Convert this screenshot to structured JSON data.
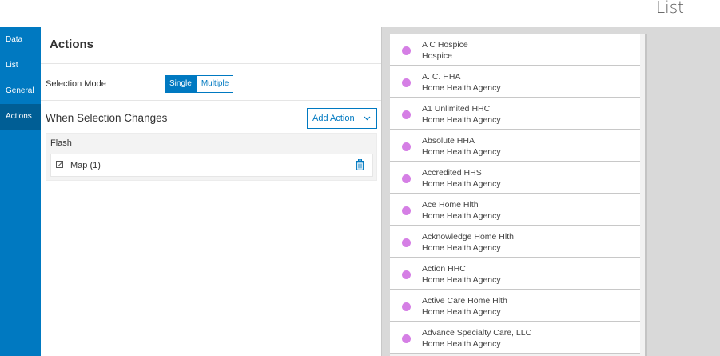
{
  "header": {
    "title": "List"
  },
  "tabs": [
    {
      "label": "Data",
      "active": false
    },
    {
      "label": "List",
      "active": false
    },
    {
      "label": "General",
      "active": false
    },
    {
      "label": "Actions",
      "active": true
    }
  ],
  "panel": {
    "title": "Actions",
    "selection_mode": {
      "label": "Selection Mode",
      "options": [
        "Single",
        "Multiple"
      ],
      "selected": "Single"
    },
    "when_selection_changes": "When Selection Changes",
    "add_action_label": "Add Action",
    "action": {
      "name": "Flash",
      "target": "Map (1)"
    }
  },
  "colors": {
    "accent": "#0079c1",
    "accent_dark": "#005e95",
    "dot": "#d57fe5"
  },
  "list": {
    "items": [
      {
        "name": "A C Hospice",
        "type": "Hospice"
      },
      {
        "name": "A. C. HHA",
        "type": "Home Health Agency"
      },
      {
        "name": "A1 Unlimited HHC",
        "type": "Home Health Agency"
      },
      {
        "name": "Absolute HHA",
        "type": "Home Health Agency"
      },
      {
        "name": "Accredited HHS",
        "type": "Home Health Agency"
      },
      {
        "name": "Ace Home Hlth",
        "type": "Home Health Agency"
      },
      {
        "name": "Acknowledge Home Hlth",
        "type": "Home Health Agency"
      },
      {
        "name": "Action HHC",
        "type": "Home Health Agency"
      },
      {
        "name": "Active Care Home Hlth",
        "type": "Home Health Agency"
      },
      {
        "name": "Advance Specialty Care, LLC",
        "type": "Home Health Agency"
      }
    ]
  }
}
